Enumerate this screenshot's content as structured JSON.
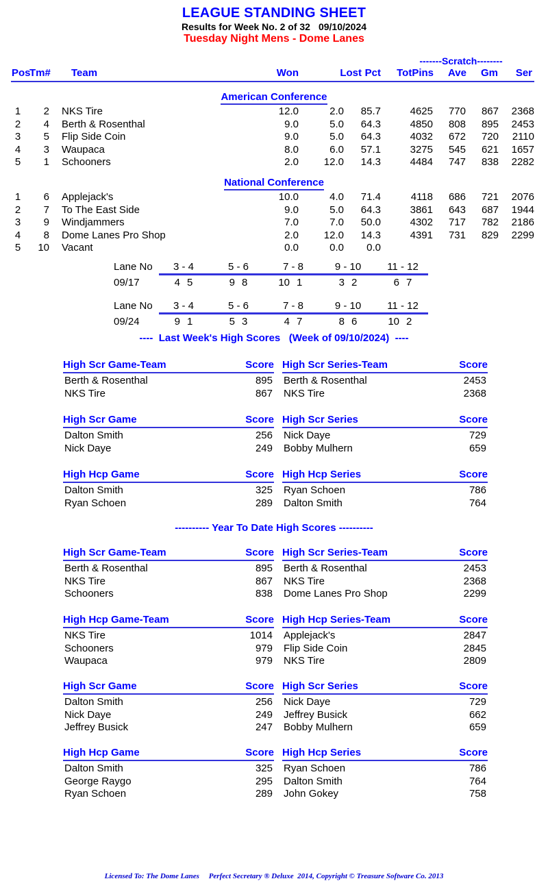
{
  "header": {
    "title": "LEAGUE STANDING SHEET",
    "results_prefix": "Results for Week No. 2 of 32",
    "results_date": "09/10/2024",
    "league_line": "Tuesday Night Mens - Dome Lanes",
    "title_color": "#0000ff",
    "league_color": "#ff0000"
  },
  "standings": {
    "scratch_group_label": "-------Scratch--------",
    "columns": {
      "pos": "Pos",
      "tm": "Tm#",
      "team": "Team",
      "won": "Won",
      "lost": "Lost",
      "pct": "Pct",
      "totpins": "TotPins",
      "ave": "Ave",
      "gm": "Gm",
      "ser": "Ser"
    },
    "conferences": [
      {
        "name": "American Conference",
        "rows": [
          {
            "pos": "1",
            "tm": "2",
            "team": "NKS Tire",
            "won": "12.0",
            "lost": "2.0",
            "pct": "85.7",
            "totpins": "4625",
            "ave": "770",
            "gm": "867",
            "ser": "2368"
          },
          {
            "pos": "2",
            "tm": "4",
            "team": "Berth & Rosenthal",
            "won": "9.0",
            "lost": "5.0",
            "pct": "64.3",
            "totpins": "4850",
            "ave": "808",
            "gm": "895",
            "ser": "2453"
          },
          {
            "pos": "3",
            "tm": "5",
            "team": "Flip Side Coin",
            "won": "9.0",
            "lost": "5.0",
            "pct": "64.3",
            "totpins": "4032",
            "ave": "672",
            "gm": "720",
            "ser": "2110"
          },
          {
            "pos": "4",
            "tm": "3",
            "team": "Waupaca",
            "won": "8.0",
            "lost": "6.0",
            "pct": "57.1",
            "totpins": "3275",
            "ave": "545",
            "gm": "621",
            "ser": "1657"
          },
          {
            "pos": "5",
            "tm": "1",
            "team": "Schooners",
            "won": "2.0",
            "lost": "12.0",
            "pct": "14.3",
            "totpins": "4484",
            "ave": "747",
            "gm": "838",
            "ser": "2282"
          }
        ]
      },
      {
        "name": "National Conference",
        "rows": [
          {
            "pos": "1",
            "tm": "6",
            "team": "Applejack's",
            "won": "10.0",
            "lost": "4.0",
            "pct": "71.4",
            "totpins": "4118",
            "ave": "686",
            "gm": "721",
            "ser": "2076"
          },
          {
            "pos": "2",
            "tm": "7",
            "team": "To The East Side",
            "won": "9.0",
            "lost": "5.0",
            "pct": "64.3",
            "totpins": "3861",
            "ave": "643",
            "gm": "687",
            "ser": "1944"
          },
          {
            "pos": "3",
            "tm": "9",
            "team": "Windjammers",
            "won": "7.0",
            "lost": "7.0",
            "pct": "50.0",
            "totpins": "4302",
            "ave": "717",
            "gm": "782",
            "ser": "2186"
          },
          {
            "pos": "4",
            "tm": "8",
            "team": "Dome Lanes Pro Shop",
            "won": "2.0",
            "lost": "12.0",
            "pct": "14.3",
            "totpins": "4391",
            "ave": "731",
            "gm": "829",
            "ser": "2299"
          },
          {
            "pos": "5",
            "tm": "10",
            "team": "Vacant",
            "won": "0.0",
            "lost": "0.0",
            "pct": "0.0",
            "totpins": "",
            "ave": "",
            "gm": "",
            "ser": ""
          }
        ]
      }
    ]
  },
  "lane_schedule": {
    "label": "Lane No",
    "pairs": [
      "3 - 4",
      "5 - 6",
      "7 - 8",
      "9 - 10",
      "11 - 12"
    ],
    "weeks": [
      {
        "date": "09/17",
        "teams": [
          [
            "4",
            "5"
          ],
          [
            "9",
            "8"
          ],
          [
            "10",
            "1"
          ],
          [
            "3",
            "2"
          ],
          [
            "6",
            "7"
          ]
        ]
      },
      {
        "date": "09/24",
        "teams": [
          [
            "9",
            "1"
          ],
          [
            "5",
            "3"
          ],
          [
            "4",
            "7"
          ],
          [
            "8",
            "6"
          ],
          [
            "10",
            "2"
          ]
        ]
      }
    ]
  },
  "last_week": {
    "banner": "----  Last Week's High Scores   (Week of 09/10/2024)  ----",
    "score_header": "Score",
    "tables": [
      {
        "left": {
          "title": "High Scr Game-Team",
          "rows": [
            [
              "Berth & Rosenthal",
              "895"
            ],
            [
              "NKS Tire",
              "867"
            ]
          ]
        },
        "right": {
          "title": "High Scr Series-Team",
          "rows": [
            [
              "Berth & Rosenthal",
              "2453"
            ],
            [
              "NKS Tire",
              "2368"
            ]
          ]
        }
      },
      {
        "left": {
          "title": "High Scr Game",
          "rows": [
            [
              "Dalton Smith",
              "256"
            ],
            [
              "Nick Daye",
              "249"
            ]
          ]
        },
        "right": {
          "title": "High Scr Series",
          "rows": [
            [
              "Nick Daye",
              "729"
            ],
            [
              "Bobby Mulhern",
              "659"
            ]
          ]
        }
      },
      {
        "left": {
          "title": "High Hcp Game",
          "rows": [
            [
              "Dalton Smith",
              "325"
            ],
            [
              "Ryan Schoen",
              "289"
            ]
          ]
        },
        "right": {
          "title": "High Hcp Series",
          "rows": [
            [
              "Ryan Schoen",
              "786"
            ],
            [
              "Dalton Smith",
              "764"
            ]
          ]
        }
      }
    ]
  },
  "year_to_date": {
    "banner": "---------- Year To Date High Scores ----------",
    "score_header": "Score",
    "tables": [
      {
        "left": {
          "title": "High Scr Game-Team",
          "rows": [
            [
              "Berth & Rosenthal",
              "895"
            ],
            [
              "NKS Tire",
              "867"
            ],
            [
              "Schooners",
              "838"
            ]
          ]
        },
        "right": {
          "title": "High Scr Series-Team",
          "rows": [
            [
              "Berth & Rosenthal",
              "2453"
            ],
            [
              "NKS Tire",
              "2368"
            ],
            [
              "Dome Lanes Pro Shop",
              "2299"
            ]
          ]
        }
      },
      {
        "left": {
          "title": "High Hcp Game-Team",
          "rows": [
            [
              "NKS Tire",
              "1014"
            ],
            [
              "Schooners",
              "979"
            ],
            [
              "Waupaca",
              "979"
            ]
          ]
        },
        "right": {
          "title": "High Hcp Series-Team",
          "rows": [
            [
              "Applejack's",
              "2847"
            ],
            [
              "Flip Side Coin",
              "2845"
            ],
            [
              "NKS Tire",
              "2809"
            ]
          ]
        }
      },
      {
        "left": {
          "title": "High Scr Game",
          "rows": [
            [
              "Dalton Smith",
              "256"
            ],
            [
              "Nick Daye",
              "249"
            ],
            [
              "Jeffrey Busick",
              "247"
            ]
          ]
        },
        "right": {
          "title": "High Scr Series",
          "rows": [
            [
              "Nick Daye",
              "729"
            ],
            [
              "Jeffrey Busick",
              "662"
            ],
            [
              "Bobby Mulhern",
              "659"
            ]
          ]
        }
      },
      {
        "left": {
          "title": "High Hcp Game",
          "rows": [
            [
              "Dalton Smith",
              "325"
            ],
            [
              "George Raygo",
              "295"
            ],
            [
              "Ryan Schoen",
              "289"
            ]
          ]
        },
        "right": {
          "title": "High Hcp Series",
          "rows": [
            [
              "Ryan Schoen",
              "786"
            ],
            [
              "Dalton Smith",
              "764"
            ],
            [
              "John Gokey",
              "758"
            ]
          ]
        }
      }
    ]
  },
  "footer": {
    "text": "Licensed To: The Dome Lanes     Perfect Secretary ® Deluxe  2014, Copyright © Treasure Software Co. 2013",
    "color": "#0000cd"
  }
}
